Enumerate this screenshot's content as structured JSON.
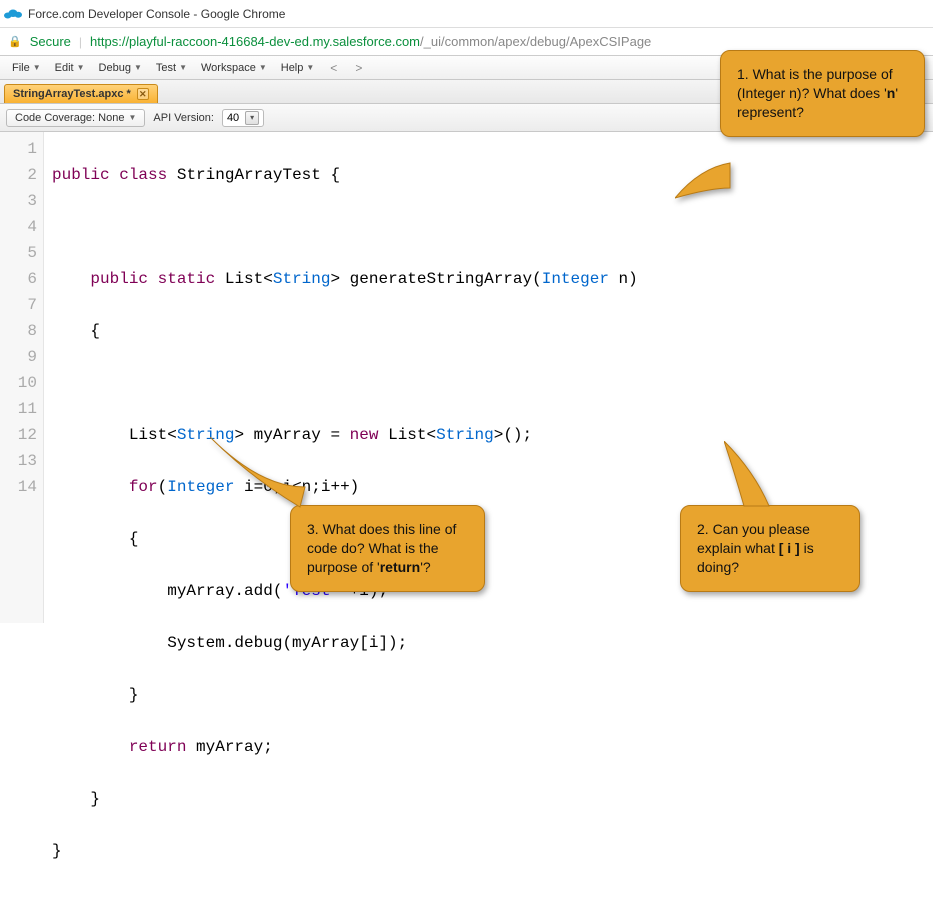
{
  "window": {
    "title": "Force.com Developer Console - Google Chrome"
  },
  "address": {
    "secure": "Secure",
    "host": "https://playful-raccoon-416684-dev-ed.my.salesforce.com",
    "path": "/_ui/common/apex/debug/ApexCSIPage"
  },
  "menubar": {
    "items": [
      "File",
      "Edit",
      "Debug",
      "Test",
      "Workspace",
      "Help"
    ],
    "nav_back": "<",
    "nav_fwd": ">"
  },
  "tabs": [
    {
      "label": "StringArrayTest.apxc *"
    }
  ],
  "toolbar": {
    "coverage_label": "Code Coverage: None",
    "api_label": "API Version:",
    "api_value": "40"
  },
  "code": {
    "lines": [
      {
        "n": 1,
        "fold": true
      },
      {
        "n": 2
      },
      {
        "n": 3
      },
      {
        "n": 4,
        "fold": true
      },
      {
        "n": 5
      },
      {
        "n": 6
      },
      {
        "n": 7
      },
      {
        "n": 8,
        "fold": true
      },
      {
        "n": 9
      },
      {
        "n": 10
      },
      {
        "n": 11
      },
      {
        "n": 12
      },
      {
        "n": 13
      },
      {
        "n": 14
      }
    ],
    "tokens": {
      "l1_public": "public",
      "l1_class": "class",
      "l1_name": "StringArrayTest",
      "l1_brace": " {",
      "l3_public": "public",
      "l3_static": "static",
      "l3_list": "List",
      "l3_lt": "<",
      "l3_string": "String",
      "l3_gt": ">",
      "l3_method": " generateStringArray(",
      "l3_int": "Integer",
      "l3_param": " n)",
      "l4": "    {",
      "l6_list": "List",
      "l6_lt": "<",
      "l6_str": "String",
      "l6_gt": ">",
      "l6_var": " myArray = ",
      "l6_new": "new",
      "l6_sp": " ",
      "l6_list2": "List",
      "l6_lt2": "<",
      "l6_str2": "String",
      "l6_gt2": ">",
      "l6_end": "();",
      "l7_for": "for",
      "l7_open": "(",
      "l7_int": "Integer",
      "l7_body": " i=0;i<n;i++)",
      "l8": "        {",
      "l9_a": "            myArray.add(",
      "l9_str": "'Test '",
      "l9_b": "+i);",
      "l10": "            System.debug(myArray[i]);",
      "l11": "        }",
      "l12_ret": "return",
      "l12_b": " myArray;",
      "l13": "    }",
      "l14": "}"
    }
  },
  "callouts": {
    "c1": {
      "text_a": "1. What is the purpose of (Integer n)? What does '",
      "bold": "n",
      "text_b": "' represent?"
    },
    "c2": {
      "text_a": "2. Can you please explain what ",
      "bold": "[ i ]",
      "text_b": " is doing?"
    },
    "c3": {
      "text_a": "3. What does this line of code do? What is the purpose of '",
      "bold": "return",
      "text_b": "'?"
    }
  }
}
